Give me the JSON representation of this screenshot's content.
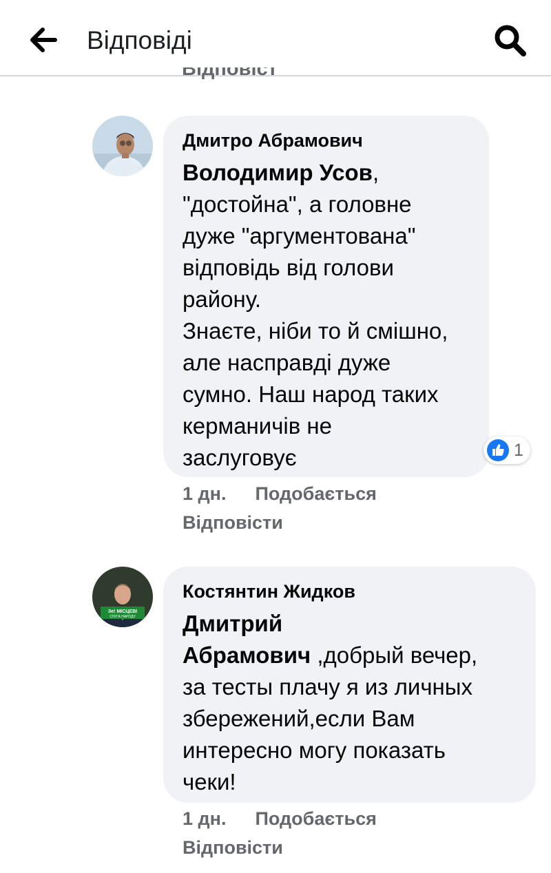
{
  "header": {
    "back_icon": "arrow-left-icon",
    "title": "Відповіді",
    "search_icon": "search-icon"
  },
  "clipped_text": "Відповісти",
  "comments": [
    {
      "author": "Дмитро Абрамович",
      "mention": "Володимир Усов",
      "text_after_mention": ",",
      "body_lines": [
        "\"достойна\", а головне",
        "дуже \"аргументована\"",
        "відповідь від голови",
        "району.",
        "Знаєте, ніби то й смішно,",
        "але насправді дуже",
        "сумно. Наш народ таких",
        "керманичів не",
        "заслуговує"
      ],
      "reaction_icon": "like-icon",
      "reaction_count": "1",
      "time": "1 дн.",
      "like_label": "Подобається",
      "reply_label": "Відповісти"
    },
    {
      "author": "Костянтин Жидков",
      "mention_line1": "Дмитрий",
      "mention_line2": "Абрамович",
      "text_after_mention": " ,добрый вечер,",
      "body_lines": [
        "за тесты плачу я из личных",
        "збережений,если Вам",
        "интересно могу показать",
        "чеки!"
      ],
      "avatar_badge_line1": "Зе! МІСЦЕВІ",
      "avatar_badge_line2": "СЛУГА НАРОДУ",
      "time": "1 дн.",
      "like_label": "Подобається",
      "reply_label": "Відповісти"
    }
  ],
  "colors": {
    "bubble": "#f0f2f5",
    "secondary_text": "#65676b",
    "like_blue": "#1877f2",
    "divider": "#d6d7da"
  }
}
